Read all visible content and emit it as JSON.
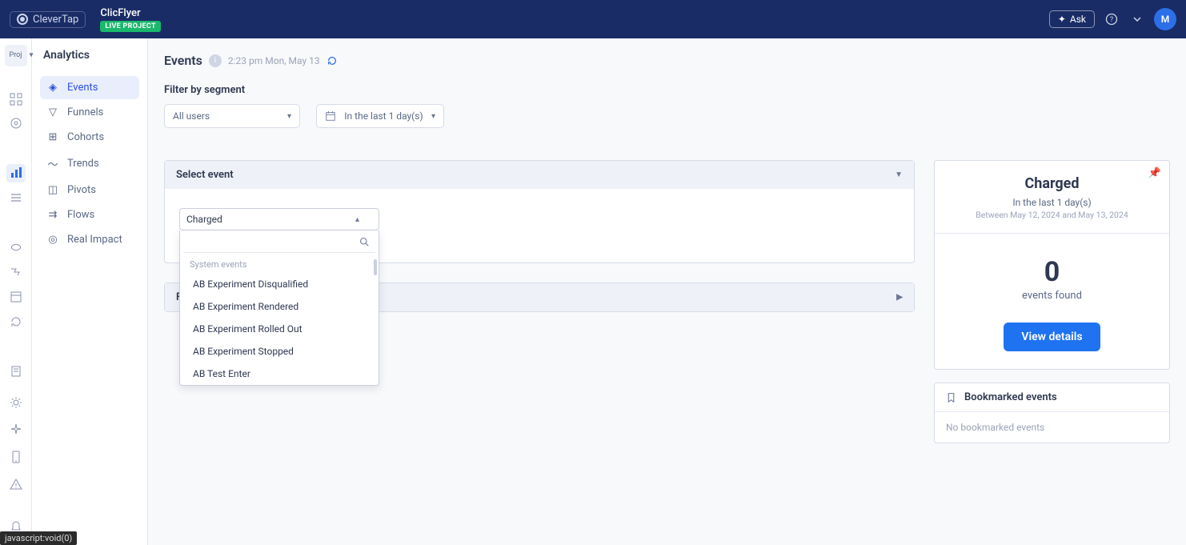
{
  "brand": "CleverTap",
  "project": {
    "name": "ClicFlyer",
    "badge": "LIVE PROJECT"
  },
  "topbar": {
    "ask": "Ask",
    "avatar_initial": "M"
  },
  "rail": {
    "proj_label": "Proj"
  },
  "subnav": {
    "title": "Analytics",
    "items": [
      {
        "label": "Events"
      },
      {
        "label": "Funnels"
      },
      {
        "label": "Cohorts"
      },
      {
        "label": "Trends"
      },
      {
        "label": "Pivots"
      },
      {
        "label": "Flows"
      },
      {
        "label": "Real Impact"
      }
    ]
  },
  "page": {
    "title": "Events",
    "timestamp": "2:23 pm Mon, May 13",
    "filter_label": "Filter by segment",
    "users_filter": "All users",
    "date_filter": "In the last 1 day(s)",
    "select_event_label": "Select event",
    "combo_selected": "Charged",
    "combo_group": "System events",
    "combo_options": [
      "AB Experiment Disqualified",
      "AB Experiment Rendered",
      "AB Experiment Rolled Out",
      "AB Experiment Stopped",
      "AB Test Enter"
    ],
    "filter_on_label": "Filter on"
  },
  "summary": {
    "title": "Charged",
    "subtitle": "In the last 1 day(s)",
    "range": "Between May 12, 2024 and May 13, 2024",
    "count": "0",
    "count_label": "events found",
    "view_btn": "View details"
  },
  "bookmarks": {
    "title": "Bookmarked events",
    "empty": "No bookmarked events"
  },
  "statusbar": "javascript:void(0)"
}
